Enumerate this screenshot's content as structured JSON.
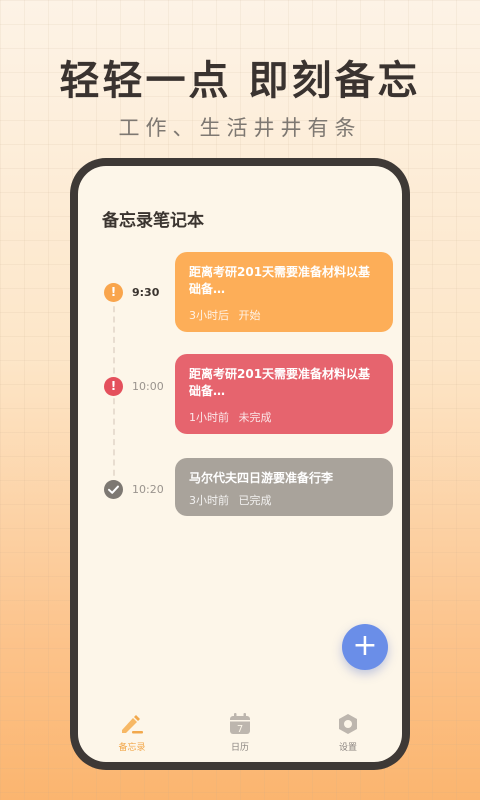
{
  "promo": {
    "headline": "轻轻一点  即刻备忘",
    "subline": "工作、生活井井有条"
  },
  "app": {
    "title": "备忘录笔记本"
  },
  "memos": [
    {
      "status_icon": "exclamation-icon",
      "time": "9:30",
      "title": "距离考研201天需要准备材料以基础备…",
      "relative": "3小时后",
      "state": "开始",
      "card_color": "#fdae58",
      "dot_color": "#f9a54c"
    },
    {
      "status_icon": "exclamation-icon",
      "time": "10:00",
      "title": "距离考研201天需要准备材料以基础备…",
      "relative": "1小时前",
      "state": "未完成",
      "card_color": "#e6646e",
      "dot_color": "#e4505c"
    },
    {
      "status_icon": "check-icon",
      "time": "10:20",
      "title": "马尔代夫四日游要准备行李",
      "relative": "3小时前",
      "state": "已完成",
      "card_color": "#a9a39b",
      "dot_color": "#7d7872"
    }
  ],
  "fab": {
    "icon": "plus-icon",
    "symbol": "+"
  },
  "tabs": [
    {
      "label": "备忘录",
      "icon": "memo-pen-icon",
      "active": true
    },
    {
      "label": "日历",
      "icon": "calendar-icon",
      "glyph": "7",
      "active": false
    },
    {
      "label": "设置",
      "icon": "settings-hex-icon",
      "active": false
    }
  ],
  "colors": {
    "accent": "#f2a84c",
    "fab": "#6a8ee8",
    "screen_bg": "#fdf6e9",
    "phone_frame": "#3e3936"
  }
}
